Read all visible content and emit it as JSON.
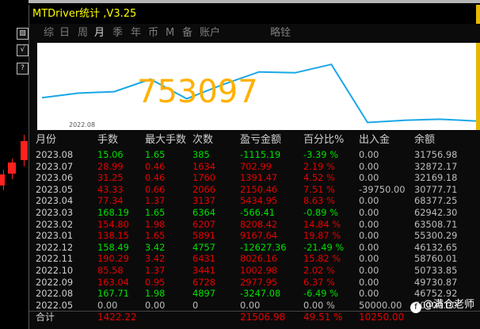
{
  "window": {
    "title": "MTDriver统计 ,V3.25"
  },
  "side_icons": [
    "▧",
    "√",
    "?"
  ],
  "tabs": [
    "综",
    "日",
    "周",
    "月",
    "季",
    "年",
    "币",
    "M",
    "备",
    "账户",
    "略铨"
  ],
  "active_tab_index": 3,
  "chart": {
    "value_label": "753097",
    "x_label": "2022.08"
  },
  "chart_data": {
    "type": "line",
    "x": [
      "2022.08",
      "2022.09",
      "2022.10",
      "2022.11",
      "2022.12",
      "2023.01",
      "2023.02",
      "2023.03",
      "2023.04",
      "2023.05",
      "2023.06",
      "2023.07",
      "2023.08"
    ],
    "values": [
      46752.92,
      49730.87,
      50733.85,
      58760.01,
      46132.65,
      55300.29,
      63508.71,
      62942.3,
      68377.25,
      30777.71,
      32169.18,
      32872.17,
      31756.98
    ],
    "color": "#1aa7e6"
  },
  "table": {
    "headers": [
      "月份",
      "手数",
      "最大手数",
      "次数",
      "盈亏金额",
      "百分比%",
      "出入金",
      "余额"
    ],
    "rows": [
      [
        "2023.08",
        "15.06",
        "1.65",
        "385",
        "-1115.19",
        "-3.39 %",
        "0.00",
        "31756.98"
      ],
      [
        "2023.07",
        "28.99",
        "0.46",
        "1634",
        "702.99",
        "2.19 %",
        "0.00",
        "32872.17"
      ],
      [
        "2023.06",
        "31.25",
        "0.46",
        "1760",
        "1391.47",
        "4.52 %",
        "0.00",
        "32169.18"
      ],
      [
        "2023.05",
        "43.33",
        "0.66",
        "2066",
        "2150.46",
        "7.51 %",
        "-39750.00",
        "30777.71"
      ],
      [
        "2023.04",
        "77.34",
        "1.37",
        "3137",
        "5434.95",
        "8.63 %",
        "0.00",
        "68377.25"
      ],
      [
        "2023.03",
        "168.19",
        "1.65",
        "6364",
        "-566.41",
        "-0.89 %",
        "0.00",
        "62942.30"
      ],
      [
        "2023.02",
        "154.80",
        "1.98",
        "6207",
        "8208.42",
        "14.84 %",
        "0.00",
        "63508.71"
      ],
      [
        "2023.01",
        "138.15",
        "1.65",
        "5891",
        "9167.64",
        "19.87 %",
        "0.00",
        "55300.29"
      ],
      [
        "2022.12",
        "158.49",
        "3.42",
        "4757",
        "-12627.36",
        "-21.49 %",
        "0.00",
        "46132.65"
      ],
      [
        "2022.11",
        "190.29",
        "3.42",
        "6431",
        "8026.16",
        "15.82 %",
        "0.00",
        "58760.01"
      ],
      [
        "2022.10",
        "85.58",
        "1.37",
        "3441",
        "1002.98",
        "2.02 %",
        "0.00",
        "50733.85"
      ],
      [
        "2022.09",
        "163.04",
        "0.95",
        "6728",
        "2977.95",
        "6.37 %",
        "0.00",
        "49730.87"
      ],
      [
        "2022.08",
        "167.71",
        "1.98",
        "4897",
        "-3247.08",
        "-6.49 %",
        "0.00",
        "46752.92"
      ],
      [
        "2022.05",
        "0.00",
        "0.00",
        "0",
        "0.00",
        "0.00 %",
        "50000.00",
        "50000.00"
      ]
    ],
    "row_colors": [
      "green",
      "red",
      "red",
      "red",
      "red",
      "green",
      "red",
      "red",
      "green",
      "red",
      "red",
      "red",
      "green",
      "gray"
    ],
    "total": [
      "合计",
      "1422.22",
      "",
      "",
      "21506.98",
      "49.51 %",
      "10250.00",
      ""
    ],
    "colors": {
      "green": "#00e000",
      "red": "#e80000",
      "gray": "#bdbdbd"
    }
  },
  "watermark": {
    "logo": "f",
    "text": "@满仓老师"
  }
}
